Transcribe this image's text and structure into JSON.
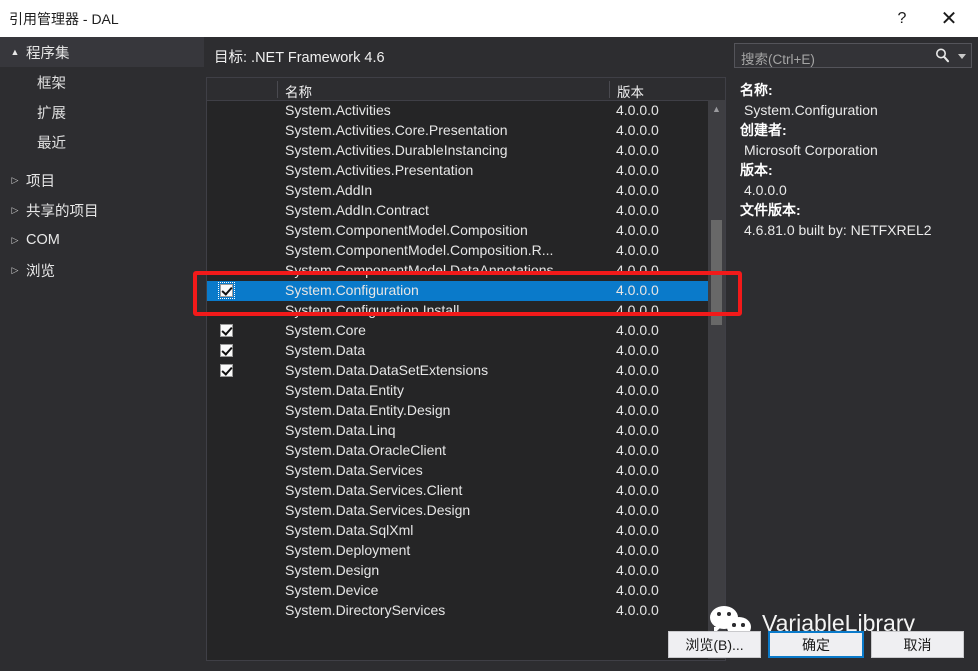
{
  "window": {
    "title": "引用管理器 - DAL",
    "help_label": "?",
    "close_label": "✕"
  },
  "sidebar": {
    "items": [
      {
        "label": "程序集",
        "arrow": "▲",
        "level": "root",
        "expanded": true
      },
      {
        "label": "框架",
        "arrow": "",
        "level": "child"
      },
      {
        "label": "扩展",
        "arrow": "",
        "level": "child"
      },
      {
        "label": "最近",
        "arrow": "",
        "level": "child"
      },
      {
        "label": "项目",
        "arrow": "▷",
        "level": "group"
      },
      {
        "label": "共享的项目",
        "arrow": "▷",
        "level": "group"
      },
      {
        "label": "COM",
        "arrow": "▷",
        "level": "group"
      },
      {
        "label": "浏览",
        "arrow": "▷",
        "level": "group"
      }
    ]
  },
  "center": {
    "target_label": "目标: .NET Framework 4.6",
    "columns": {
      "name": "名称",
      "version": "版本"
    },
    "scroll": {
      "up_arrow": "▲",
      "down_arrow": "▼"
    },
    "rows": [
      {
        "name": "System.Activities",
        "version": "4.0.0.0",
        "checked": false,
        "selected": false
      },
      {
        "name": "System.Activities.Core.Presentation",
        "version": "4.0.0.0",
        "checked": false,
        "selected": false
      },
      {
        "name": "System.Activities.DurableInstancing",
        "version": "4.0.0.0",
        "checked": false,
        "selected": false
      },
      {
        "name": "System.Activities.Presentation",
        "version": "4.0.0.0",
        "checked": false,
        "selected": false
      },
      {
        "name": "System.AddIn",
        "version": "4.0.0.0",
        "checked": false,
        "selected": false
      },
      {
        "name": "System.AddIn.Contract",
        "version": "4.0.0.0",
        "checked": false,
        "selected": false
      },
      {
        "name": "System.ComponentModel.Composition",
        "version": "4.0.0.0",
        "checked": false,
        "selected": false
      },
      {
        "name": "System.ComponentModel.Composition.R...",
        "version": "4.0.0.0",
        "checked": false,
        "selected": false
      },
      {
        "name": "System.ComponentModel.DataAnnotations",
        "version": "4.0.0.0",
        "checked": false,
        "selected": false
      },
      {
        "name": "System.Configuration",
        "version": "4.0.0.0",
        "checked": true,
        "selected": true
      },
      {
        "name": "System.Configuration.Install",
        "version": "4.0.0.0",
        "checked": false,
        "selected": false
      },
      {
        "name": "System.Core",
        "version": "4.0.0.0",
        "checked": true,
        "selected": false
      },
      {
        "name": "System.Data",
        "version": "4.0.0.0",
        "checked": true,
        "selected": false
      },
      {
        "name": "System.Data.DataSetExtensions",
        "version": "4.0.0.0",
        "checked": true,
        "selected": false
      },
      {
        "name": "System.Data.Entity",
        "version": "4.0.0.0",
        "checked": false,
        "selected": false
      },
      {
        "name": "System.Data.Entity.Design",
        "version": "4.0.0.0",
        "checked": false,
        "selected": false
      },
      {
        "name": "System.Data.Linq",
        "version": "4.0.0.0",
        "checked": false,
        "selected": false
      },
      {
        "name": "System.Data.OracleClient",
        "version": "4.0.0.0",
        "checked": false,
        "selected": false
      },
      {
        "name": "System.Data.Services",
        "version": "4.0.0.0",
        "checked": false,
        "selected": false
      },
      {
        "name": "System.Data.Services.Client",
        "version": "4.0.0.0",
        "checked": false,
        "selected": false
      },
      {
        "name": "System.Data.Services.Design",
        "version": "4.0.0.0",
        "checked": false,
        "selected": false
      },
      {
        "name": "System.Data.SqlXml",
        "version": "4.0.0.0",
        "checked": false,
        "selected": false
      },
      {
        "name": "System.Deployment",
        "version": "4.0.0.0",
        "checked": false,
        "selected": false
      },
      {
        "name": "System.Design",
        "version": "4.0.0.0",
        "checked": false,
        "selected": false
      },
      {
        "name": "System.Device",
        "version": "4.0.0.0",
        "checked": false,
        "selected": false
      },
      {
        "name": "System.DirectoryServices",
        "version": "4.0.0.0",
        "checked": false,
        "selected": false
      }
    ]
  },
  "right": {
    "search": {
      "placeholder": "搜索(Ctrl+E)",
      "value": ""
    },
    "details": [
      {
        "key": "名称:",
        "value": "System.Configuration"
      },
      {
        "key": "创建者:",
        "value": "Microsoft Corporation"
      },
      {
        "key": "版本:",
        "value": "4.0.0.0"
      },
      {
        "key": "文件版本:",
        "value": "4.6.81.0 built by: NETFXREL2"
      }
    ]
  },
  "footer": {
    "browse_label": "浏览(B)...",
    "ok_label": "确定",
    "cancel_label": "取消"
  },
  "watermark": {
    "text": "VariableLibrary"
  },
  "colors": {
    "selection_blue": "#0a7aca",
    "annotation_red": "#f21a1a",
    "window_bg": "#2d2d30",
    "list_bg": "#252526",
    "titlebar_bg": "#ffffff"
  }
}
